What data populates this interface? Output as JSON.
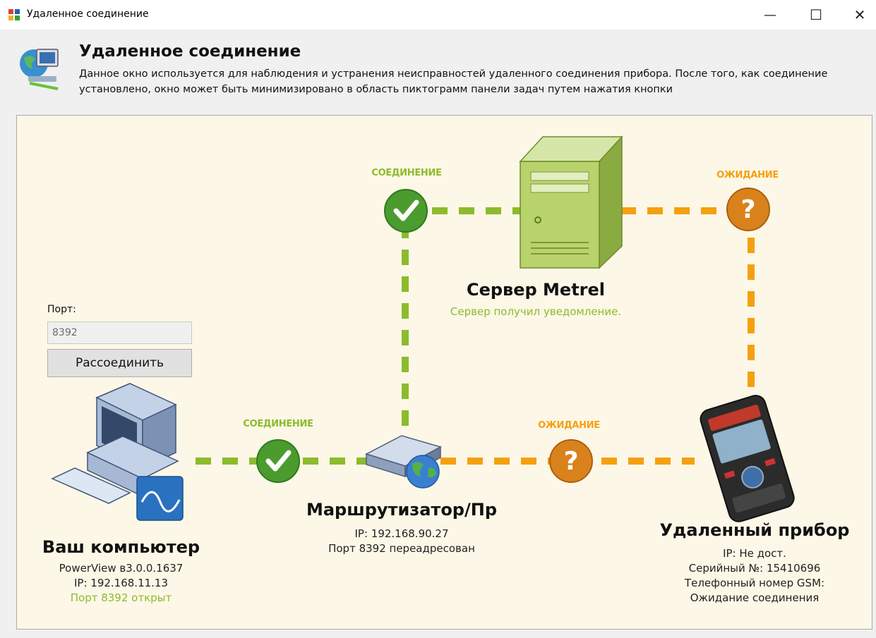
{
  "window": {
    "title": "Удаленное соединение",
    "minimize": "—",
    "maximize": "☐",
    "close": "✕"
  },
  "header": {
    "title": "Удаленное соединение",
    "description": "Данное окно используется для наблюдения и устранения неисправностей удаленного соединения прибора. После того, как соединение установлено, окно может быть минимизировано в область пиктограмм панели задач путем нажатия кнопки",
    "icon": "network-computer-icon"
  },
  "colors": {
    "connected": "#8dbb2c",
    "waiting": "#f5a00f",
    "panel_bg": "#fdf7e7"
  },
  "links": {
    "pc_router": {
      "status": "СОЕДИНЕНИЕ",
      "icon": "check-icon"
    },
    "router_server": {
      "status": "СОЕДИНЕНИЕ",
      "icon": "check-icon"
    },
    "server_device": {
      "status": "ОЖИДАНИЕ",
      "icon": "question-icon"
    },
    "router_device": {
      "status": "ОЖИДАНИЕ",
      "icon": "question-icon"
    }
  },
  "server": {
    "name": "Сервер Metrel",
    "status": "Сервер получил уведомление."
  },
  "router": {
    "name": "Маршрутизатор/Пр",
    "ip": "IP: 192.168.90.27",
    "port": "Порт 8392 переадресован"
  },
  "computer": {
    "name": "Ваш компьютер",
    "version": "PowerView в3.0.0.1637",
    "ip": "IP: 192.168.11.13",
    "port": "Порт 8392 открыт",
    "port_label": "Порт:",
    "port_value": "8392",
    "disconnect_label": "Рассоединить"
  },
  "device": {
    "name": "Удаленный прибор",
    "ip": "IP: Не дост.",
    "serial": "Серийный №: 15410696",
    "gsm": "Телефонный номер GSM:",
    "state": "Ожидание соединения"
  }
}
